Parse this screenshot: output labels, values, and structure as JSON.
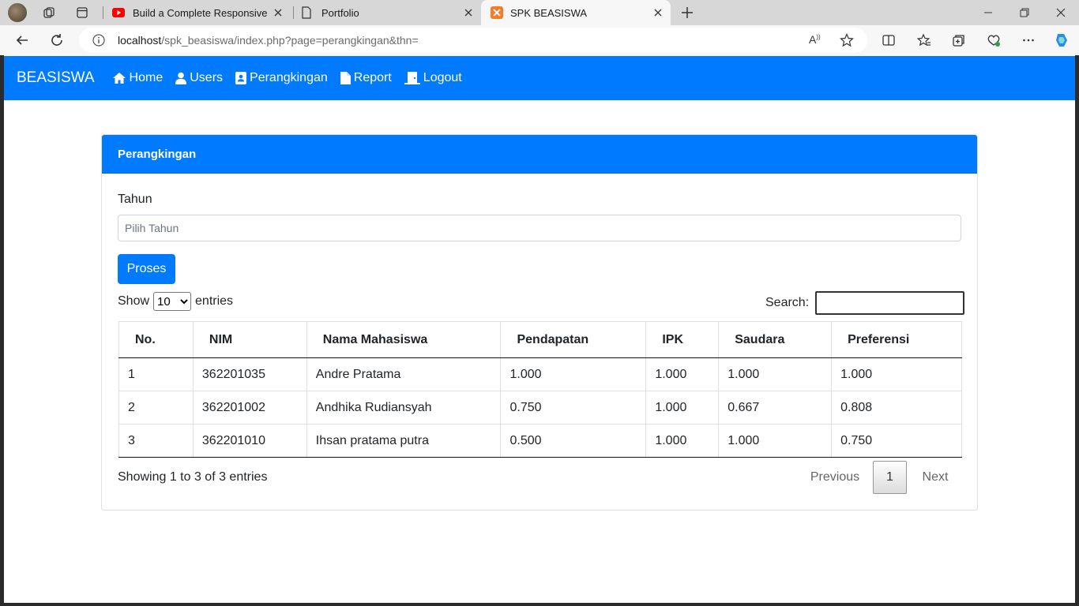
{
  "browser": {
    "tabs": [
      {
        "title": "Build a Complete Responsive Per",
        "favicon": "youtube-icon"
      },
      {
        "title": "Portfolio",
        "favicon": "page-icon"
      },
      {
        "title": "SPK BEASISWA",
        "favicon": "xampp-icon"
      }
    ],
    "url_host": "localhost",
    "url_path": "/spk_beasiswa/index.php?page=perangkingan&thn="
  },
  "navbar": {
    "brand": "BEASISWA",
    "items": [
      {
        "label": "Home",
        "icon": "home-icon"
      },
      {
        "label": "Users",
        "icon": "user-icon"
      },
      {
        "label": "Perangkingan",
        "icon": "id-card-icon"
      },
      {
        "label": "Report",
        "icon": "file-icon"
      },
      {
        "label": "Logout",
        "icon": "door-icon"
      }
    ],
    "color": "#007bff"
  },
  "card": {
    "header": "Perangkingan",
    "tahun_label": "Tahun",
    "tahun_placeholder": "Pilih Tahun",
    "button_label": "Proses"
  },
  "datatable": {
    "show_label": "Show",
    "entries_label": "entries",
    "page_length": "10",
    "search_label": "Search:",
    "columns": [
      "No.",
      "NIM",
      "Nama Mahasiswa",
      "Pendapatan",
      "IPK",
      "Saudara",
      "Preferensi"
    ],
    "rows": [
      [
        "1",
        "362201035",
        "Andre Pratama",
        "1.000",
        "1.000",
        "1.000",
        "1.000"
      ],
      [
        "2",
        "362201002",
        "Andhika Rudiansyah",
        "0.750",
        "1.000",
        "0.667",
        "0.808"
      ],
      [
        "3",
        "362201010",
        "Ihsan pratama putra",
        "0.500",
        "1.000",
        "1.000",
        "0.750"
      ]
    ],
    "info": "Showing 1 to 3 of 3 entries",
    "pagination": {
      "previous": "Previous",
      "current": "1",
      "next": "Next"
    }
  }
}
